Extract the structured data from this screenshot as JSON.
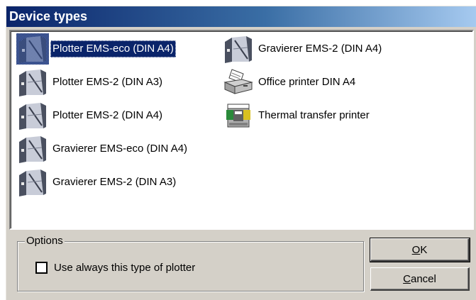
{
  "window": {
    "title": "Device types"
  },
  "list": {
    "items": [
      {
        "label": "Plotter EMS-eco (DIN A4)",
        "icon": "plotter-icon",
        "selected": true
      },
      {
        "label": "Plotter EMS-2 (DIN A3)",
        "icon": "plotter-icon",
        "selected": false
      },
      {
        "label": "Plotter EMS-2 (DIN A4)",
        "icon": "plotter-icon",
        "selected": false
      },
      {
        "label": "Gravierer EMS-eco (DIN A4)",
        "icon": "plotter-icon",
        "selected": false
      },
      {
        "label": "Gravierer EMS-2 (DIN A3)",
        "icon": "plotter-icon",
        "selected": false
      },
      {
        "label": "Gravierer EMS-2 (DIN A4)",
        "icon": "plotter-icon",
        "selected": false
      },
      {
        "label": "Office printer DIN A4",
        "icon": "office-printer-icon",
        "selected": false
      },
      {
        "label": "Thermal transfer printer",
        "icon": "thermal-printer-icon",
        "selected": false
      }
    ]
  },
  "options": {
    "legend": "Options",
    "checkbox_label": "Use always this type of plotter",
    "checked": false
  },
  "buttons": {
    "ok": {
      "mnemonic": "O",
      "rest": "K"
    },
    "cancel": {
      "mnemonic": "C",
      "rest": "ancel"
    }
  },
  "colors": {
    "selection": "#0a246a",
    "titlebar_start": "#0a246a",
    "titlebar_end": "#a6caf0",
    "dialog_bg": "#d4d0c8"
  }
}
